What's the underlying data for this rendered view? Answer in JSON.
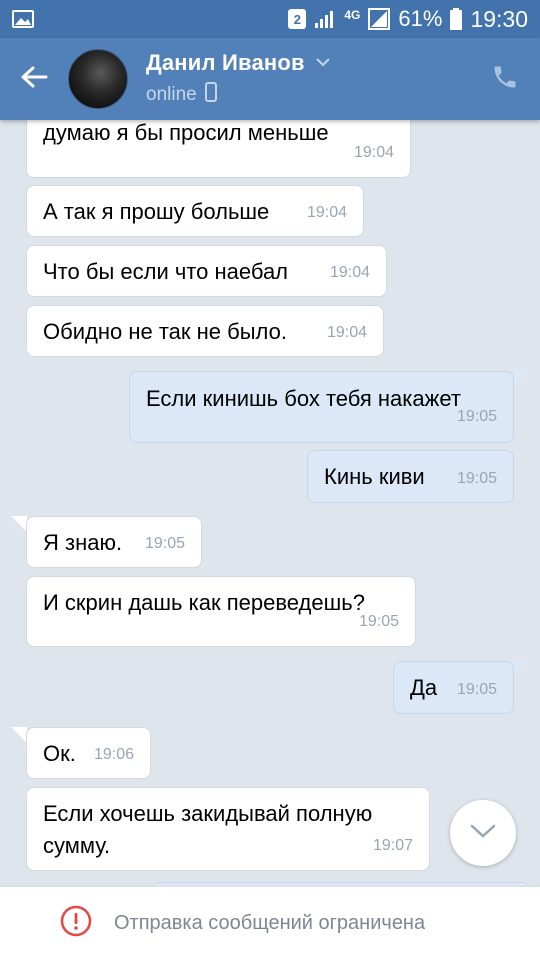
{
  "status_bar": {
    "sim_badge": "2",
    "network": "4G",
    "battery": "61%",
    "time": "19:30"
  },
  "header": {
    "contact_name": "Данил Иванов",
    "status": "online"
  },
  "messages": [
    {
      "dir": "in",
      "text": "думаю я бы просил меньше",
      "time": "19:04"
    },
    {
      "dir": "in",
      "text": "А так я прошу больше",
      "time": "19:04"
    },
    {
      "dir": "in",
      "text": "Что бы если что наебал",
      "time": "19:04"
    },
    {
      "dir": "in",
      "text": "Обидно не так не было.",
      "time": "19:04"
    },
    {
      "dir": "out",
      "text": "Если кинишь бох тебя накажет",
      "time": "19:05"
    },
    {
      "dir": "out",
      "text": "Кинь киви",
      "time": "19:05"
    },
    {
      "dir": "in",
      "text": "Я знаю.",
      "time": "19:05"
    },
    {
      "dir": "in",
      "text": "И скрин дашь как переведешь?",
      "time": "19:05"
    },
    {
      "dir": "out",
      "text": "Да",
      "time": "19:05"
    },
    {
      "dir": "in",
      "text": "Ок.",
      "time": "19:06"
    },
    {
      "dir": "in",
      "text": "Если хочешь закидывай полную сумму.",
      "time": "19:07"
    }
  ],
  "bottom_bar": {
    "notice": "Отправка сообщений ограничена"
  },
  "colors": {
    "status_bar": "#4273ac",
    "header": "#5181b8",
    "chat_bg": "#dfe5ec",
    "incoming": "#ffffff",
    "outgoing": "#dce8f7",
    "warning": "#e64646"
  },
  "icons": [
    "gallery-icon",
    "signal-icon",
    "battery-icon",
    "back-arrow-icon",
    "chevron-down-icon",
    "phone-icon",
    "mobile-icon",
    "chevron-down-icon",
    "warning-icon"
  ]
}
